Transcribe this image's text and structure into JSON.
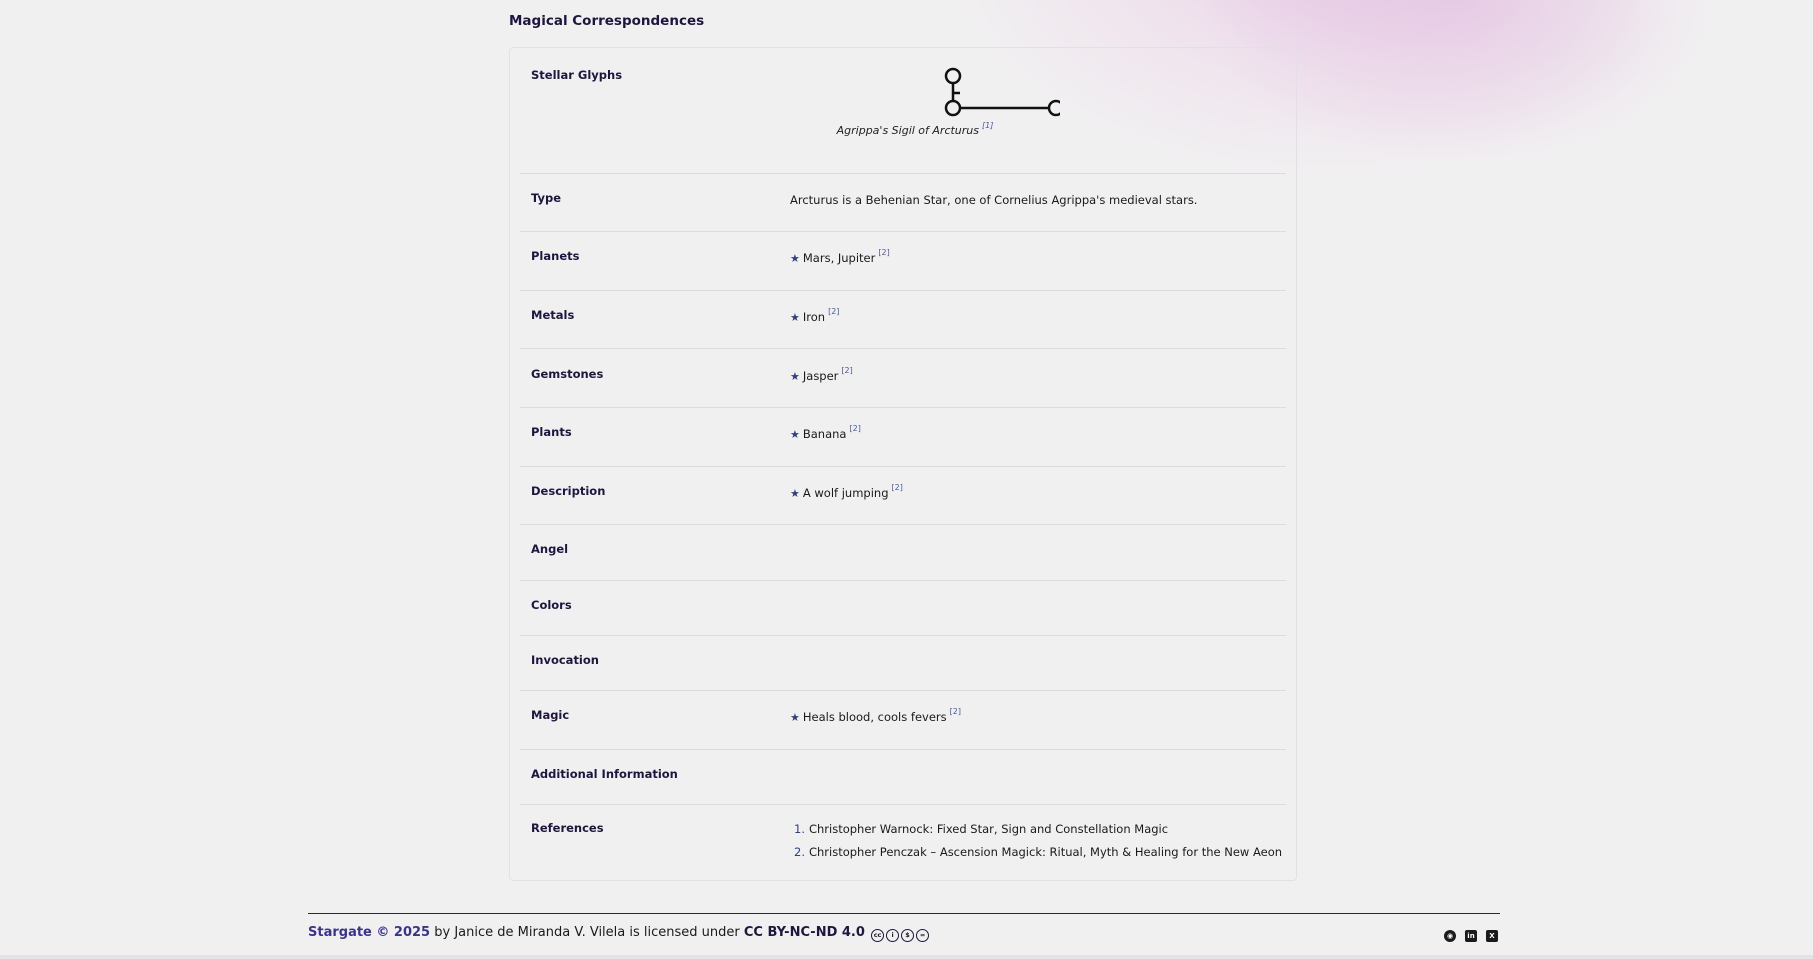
{
  "section_title": "Magical Correspondences",
  "rows": {
    "glyphs": {
      "label": "Stellar Glyphs",
      "caption": "Agrippa's Sigil of Arcturus",
      "ref": "[1]"
    },
    "type": {
      "label": "Type",
      "value": "Arcturus is a Behenian Star, one of Cornelius Agrippa's medieval stars."
    },
    "planets": {
      "label": "Planets",
      "value": "Mars, Jupiter",
      "ref": "[2]"
    },
    "metals": {
      "label": "Metals",
      "value": "Iron",
      "ref": "[2]"
    },
    "gemstones": {
      "label": "Gemstones",
      "value": "Jasper",
      "ref": "[2]"
    },
    "plants": {
      "label": "Plants",
      "value": "Banana",
      "ref": "[2]"
    },
    "description": {
      "label": "Description",
      "value": "A wolf jumping",
      "ref": "[2]"
    },
    "angel": {
      "label": "Angel"
    },
    "colors": {
      "label": "Colors"
    },
    "invocation": {
      "label": "Invocation"
    },
    "magic": {
      "label": "Magic",
      "value": "Heals blood, cools fevers",
      "ref": "[2]"
    },
    "additional": {
      "label": "Additional Information"
    },
    "references": {
      "label": "References",
      "items": [
        {
          "num": "1.",
          "text": "Christopher Warnock: Fixed Star, Sign and Constellation Magic"
        },
        {
          "num": "2.",
          "text": "Christopher Penczak – Ascension Magick: Ritual, Myth & Healing for the New Aeon"
        }
      ]
    }
  },
  "star_glyph": "★",
  "footer": {
    "brand": "Stargate © 2025",
    "by_text": " by Janice de Miranda V. Vilela is licensed under ",
    "license": "CC BY-NC-ND 4.0",
    "cc_icons": [
      "cc",
      "by",
      "nc",
      "nd"
    ],
    "social_icons": [
      "github-icon",
      "linkedin-icon",
      "x-icon"
    ]
  }
}
